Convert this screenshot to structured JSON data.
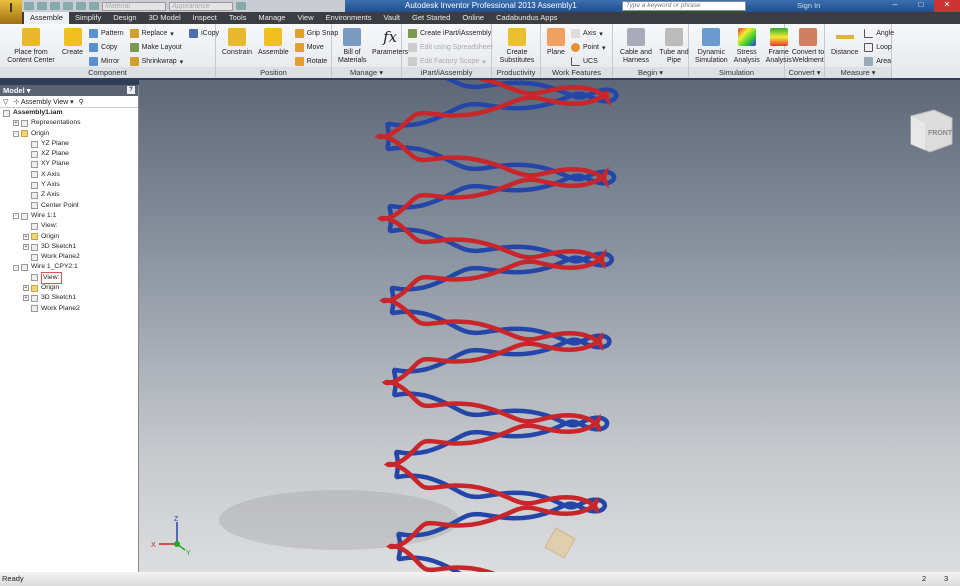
{
  "qat": {
    "material": "Material",
    "appearance": "Appearance"
  },
  "title": "Autodesk Inventor Professional 2013   Assembly1",
  "search_placeholder": "Type a keyword or phrase",
  "sign_in": "Sign In",
  "tabs": [
    "Assemble",
    "Simplify",
    "Design",
    "3D Model",
    "Inspect",
    "Tools",
    "Manage",
    "View",
    "Environments",
    "Vault",
    "Get Started",
    "Online",
    "Cadabundus Apps"
  ],
  "ribbon": {
    "component": {
      "label": "Component",
      "place": "Place from Content Center",
      "create": "Create",
      "pattern": "Pattern",
      "copy": "Copy",
      "mirror": "Mirror",
      "replace": "Replace",
      "make_layout": "Make Layout",
      "shrinkwrap": "Shrinkwrap",
      "icopy": "iCopy"
    },
    "position": {
      "label": "Position",
      "constrain": "Constrain",
      "assemble": "Assemble",
      "grip_snap": "Grip Snap",
      "move": "Move",
      "rotate": "Rotate"
    },
    "manage": {
      "label": "Manage",
      "bom": "Bill of Materials",
      "parameters": "Parameters"
    },
    "ipart": {
      "label": "iPart/iAssembly",
      "create": "Create iPart/iAssembly",
      "edit_spreadsheet": "Edit using Spreadsheet",
      "edit_factory": "Edit Factory Scope"
    },
    "productivity": {
      "label": "Productivity",
      "create_sub": "Create Substitutes"
    },
    "work_features": {
      "label": "Work Features",
      "plane": "Plane",
      "axis": "Axis",
      "point": "Point",
      "ucs": "UCS"
    },
    "begin": {
      "label": "Begin",
      "cable": "Cable and Harness",
      "tube": "Tube and Pipe"
    },
    "simulation": {
      "label": "Simulation",
      "dynamic": "Dynamic Simulation",
      "stress": "Stress Analysis",
      "frame": "Frame Analysis"
    },
    "convert": {
      "label": "Convert",
      "weldment": "Convert to Weldment"
    },
    "measure": {
      "label": "Measure",
      "distance": "Distance",
      "angle": "Angle",
      "loop": "Loop",
      "area": "Area"
    }
  },
  "browser": {
    "title": "Model",
    "view": "Assembly View",
    "tree": [
      {
        "label": "Assembly1.iam",
        "depth": 0,
        "bold": true
      },
      {
        "label": "Representations",
        "depth": 1,
        "exp": "+"
      },
      {
        "label": "Origin",
        "depth": 1,
        "exp": "-",
        "folder": true
      },
      {
        "label": "YZ Plane",
        "depth": 2
      },
      {
        "label": "XZ Plane",
        "depth": 2
      },
      {
        "label": "XY Plane",
        "depth": 2
      },
      {
        "label": "X Axis",
        "depth": 2
      },
      {
        "label": "Y Axis",
        "depth": 2
      },
      {
        "label": "Z Axis",
        "depth": 2
      },
      {
        "label": "Center Point",
        "depth": 2
      },
      {
        "label": "Wire 1:1",
        "depth": 1,
        "exp": "-"
      },
      {
        "label": "View:",
        "depth": 2
      },
      {
        "label": "Origin",
        "depth": 2,
        "exp": "+",
        "folder": true
      },
      {
        "label": "3D Sketch1",
        "depth": 2,
        "exp": "+"
      },
      {
        "label": "Work Plane2",
        "depth": 2
      },
      {
        "label": "Wire 1_CPY2:1",
        "depth": 1,
        "exp": "-"
      },
      {
        "label": "View:",
        "depth": 2,
        "selected": true
      },
      {
        "label": "Origin",
        "depth": 2,
        "exp": "+",
        "folder": true
      },
      {
        "label": "3D Sketch1",
        "depth": 2,
        "exp": "+"
      },
      {
        "label": "Work Plane2",
        "depth": 2
      }
    ]
  },
  "viewcube": {
    "face": "FRONT"
  },
  "triad": {
    "x": "X",
    "y": "Y",
    "z": "Z"
  },
  "status": {
    "text": "Ready",
    "n1": "2",
    "n2": "3"
  },
  "colors": {
    "wire1": "#c8262a",
    "wire2": "#2446a8"
  }
}
